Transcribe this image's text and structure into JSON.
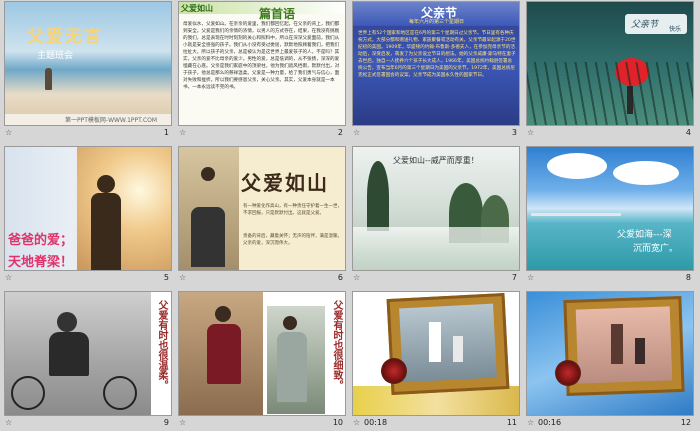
{
  "slides": [
    {
      "num": "1",
      "title": "父爱无言",
      "subtitle": "主题班会",
      "footer": "第一PPT模板网-WWW.1PPT.COM"
    },
    {
      "num": "2",
      "title": "篇首语",
      "tag": "父爱如山",
      "body": "母爱似水，父爱如山。在亲亲的爱里，我们都回忆起，在父亲的背上，我们都到安全。父爱是我们的亲情的浓情，以男人的方式存在，结果，在我没有挑剔的我们，总是表现在时时刻刻的关心和照料中，所以在深深父爱面前，我们从小就是安全感强的孩子。我们从小没有受过委屈，默默地照顾着我们，把我们拉扯大，所以孩子的父亲，总是被认为是这世界上最爱孩子的人，不是吗？其实，父亲的爱不比母亲的爱少。男性的爱，总是低调的，从不张扬，深深的爱埋藏在心底。父亲是我们家庭中的顶梁柱，他为我们遮风挡雨，默默付出，对于孩子，他总是那么的慈祥温柔。父爱是一种力量，给了我们勇气与信心，面对失败和挫折。所以我们要感恩父亲，关心父亲。其实，父爱本身就是一本书，一本永远读不完的书。"
    },
    {
      "num": "3",
      "title": "父亲节",
      "subtitle": "每年六月的第三个星期日",
      "body": "世界上有52个国家和地区是在6月的第三个星期日过父亲节。节日里有各种庆祝方式，大部分都和赠送礼物、家族聚餐或活动有关。父亲节最早起源于20世纪初的美国。1909年，华盛顿的约翰·布鲁斯·多德夫人，在参加完母亲节的活动后，深受启发，萌发了为父亲设立节日的想法。她的父亲威廉·斯马特在妻子去世后，独自一人抚养六个孩子长大成人。1966年，美国总统约翰逊签署总统公告，宣布当年6月的第三个星期日为美国的父亲节。1972年，美国总统尼克松正式签署国会的议案，父亲节成为美国永久性的国家节日。"
    },
    {
      "num": "4",
      "title": "父亲节",
      "subtitle": "快乐"
    },
    {
      "num": "5",
      "line1": "爸爸的爱；",
      "line2": "天地脊梁！"
    },
    {
      "num": "6",
      "title": "父爱如山",
      "text1": "有一种爱化作高山，有一种责任守护着一生一世，不求回报，只是默默付出。这就是父爱。",
      "text2": "责备的背后，藏着关怀；无声的陪伴，满是温暖。父亲的爱，深沉而伟大。"
    },
    {
      "num": "7",
      "title": "父爱如山--威严而厚重！"
    },
    {
      "num": "8",
      "line1": "父爱如海---深",
      "line2": "沉而宽广。"
    },
    {
      "num": "9",
      "caption": "父爱有时也很温柔。"
    },
    {
      "num": "10",
      "caption": "父爱有时也很细致。"
    },
    {
      "num": "11",
      "time": "00:18"
    },
    {
      "num": "12",
      "time": "00:16"
    }
  ],
  "icons": {
    "star": "☆"
  }
}
